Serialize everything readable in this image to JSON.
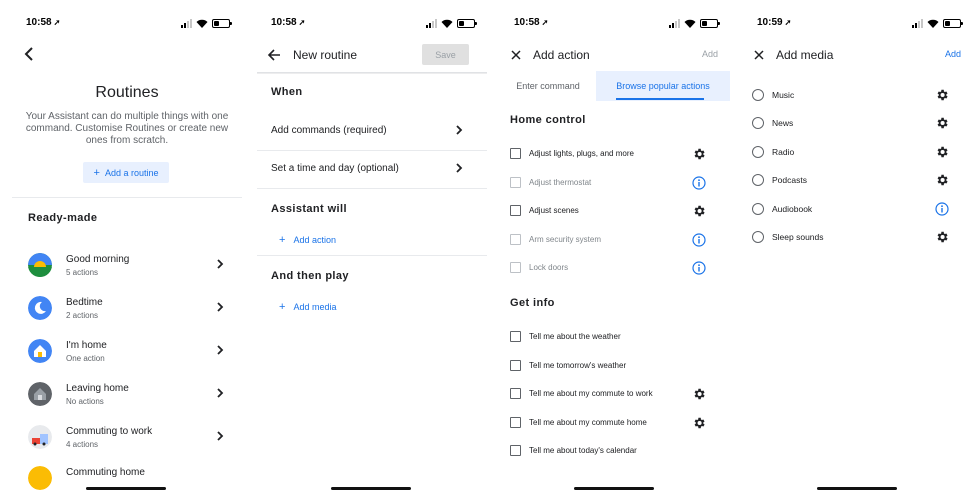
{
  "status_times": [
    "10:58",
    "10:58",
    "10:58",
    "10:59"
  ],
  "status_loc_glyph": "➚",
  "routines_screen": {
    "title": "Routines",
    "description": "Your Assistant can do multiple things with one command. Customise Routines or create new ones from scratch.",
    "add_button": "Add a routine",
    "section_title": "Ready-made",
    "items": [
      {
        "name": "Good morning",
        "sub": "5 actions",
        "icon": "sunrise-icon"
      },
      {
        "name": "Bedtime",
        "sub": "2 actions",
        "icon": "moon-icon"
      },
      {
        "name": "I'm home",
        "sub": "One action",
        "icon": "house-icon"
      },
      {
        "name": "Leaving home",
        "sub": "No actions",
        "icon": "leaving-home-icon"
      },
      {
        "name": "Commuting to work",
        "sub": "4 actions",
        "icon": "commute-icon"
      },
      {
        "name": "Commuting home",
        "sub": "",
        "icon": "commute-home-icon"
      }
    ]
  },
  "new_routine_screen": {
    "title": "New routine",
    "save_label": "Save",
    "when_header": "When",
    "add_commands": "Add commands (required)",
    "set_time": "Set a time and day (optional)",
    "assistant_header": "Assistant will",
    "add_action": "Add action",
    "then_header": "And then play",
    "add_media": "Add media"
  },
  "add_action_screen": {
    "title": "Add action",
    "add_label": "Add",
    "tabs": [
      "Enter command",
      "Browse popular actions"
    ],
    "home_control_header": "Home control",
    "home_control": [
      {
        "label": "Adjust lights, plugs, and more",
        "dim": false,
        "icon": "gear"
      },
      {
        "label": "Adjust thermostat",
        "dim": true,
        "icon": "info"
      },
      {
        "label": "Adjust scenes",
        "dim": false,
        "icon": "gear"
      },
      {
        "label": "Arm security system",
        "dim": true,
        "icon": "info"
      },
      {
        "label": "Lock doors",
        "dim": true,
        "icon": "info"
      }
    ],
    "get_info_header": "Get info",
    "get_info": [
      {
        "label": "Tell me about the weather",
        "dim": false,
        "icon": ""
      },
      {
        "label": "Tell me tomorrow's weather",
        "dim": false,
        "icon": ""
      },
      {
        "label": "Tell me about my commute to work",
        "dim": false,
        "icon": "gear"
      },
      {
        "label": "Tell me about my commute home",
        "dim": false,
        "icon": "gear"
      },
      {
        "label": "Tell me about today's calendar",
        "dim": false,
        "icon": ""
      }
    ]
  },
  "add_media_screen": {
    "title": "Add media",
    "add_label": "Add",
    "items": [
      {
        "label": "Music",
        "icon": "gear"
      },
      {
        "label": "News",
        "icon": "gear"
      },
      {
        "label": "Radio",
        "icon": "gear"
      },
      {
        "label": "Podcasts",
        "icon": "gear"
      },
      {
        "label": "Audiobook",
        "icon": "info"
      },
      {
        "label": "Sleep sounds",
        "icon": "gear"
      }
    ]
  },
  "colors": {
    "accent": "#1a73e8",
    "accent_bg": "#e8f0fe",
    "text": "#202124",
    "muted": "#5f6368"
  },
  "battery_level": 0.35
}
